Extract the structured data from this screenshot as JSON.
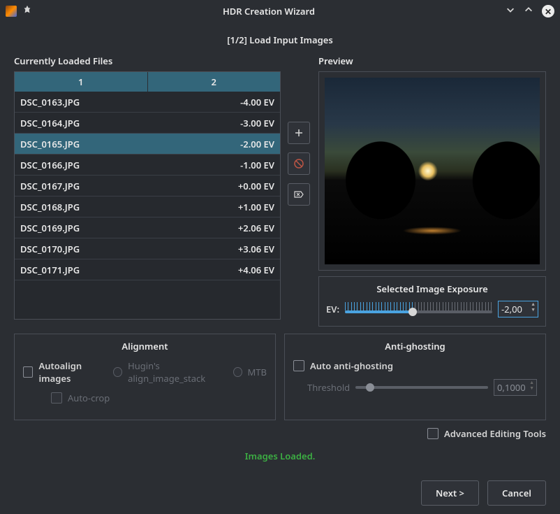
{
  "titlebar": {
    "title": "HDR Creation Wizard"
  },
  "step_title": "[1/2] Load Input Images",
  "left": {
    "label": "Currently Loaded Files",
    "headers": [
      "1",
      "2"
    ],
    "rows": [
      {
        "file": "DSC_0163.JPG",
        "ev": "-4.00 EV",
        "selected": false
      },
      {
        "file": "DSC_0164.JPG",
        "ev": "-3.00 EV",
        "selected": false
      },
      {
        "file": "DSC_0165.JPG",
        "ev": "-2.00 EV",
        "selected": true
      },
      {
        "file": "DSC_0166.JPG",
        "ev": "-1.00 EV",
        "selected": false
      },
      {
        "file": "DSC_0167.JPG",
        "ev": "+0.00 EV",
        "selected": false
      },
      {
        "file": "DSC_0168.JPG",
        "ev": "+1.00 EV",
        "selected": false
      },
      {
        "file": "DSC_0169.JPG",
        "ev": "+2.06 EV",
        "selected": false
      },
      {
        "file": "DSC_0170.JPG",
        "ev": "+3.06 EV",
        "selected": false
      },
      {
        "file": "DSC_0171.JPG",
        "ev": "+4.06 EV",
        "selected": false
      }
    ]
  },
  "preview": {
    "label": "Preview"
  },
  "exposure": {
    "title": "Selected Image Exposure",
    "label": "EV:",
    "value": "-2,00"
  },
  "alignment": {
    "title": "Alignment",
    "autoalign": "Autoalign images",
    "hugin": "Hugin's align_image_stack",
    "mtb": "MTB",
    "autocrop": "Auto-crop"
  },
  "antighost": {
    "title": "Anti-ghosting",
    "auto": "Auto anti-ghosting",
    "threshold": "Threshold",
    "threshold_value": "0,1000"
  },
  "advanced": "Advanced Editing Tools",
  "status": "Images Loaded.",
  "footer": {
    "next": "Next >",
    "cancel": "Cancel"
  }
}
